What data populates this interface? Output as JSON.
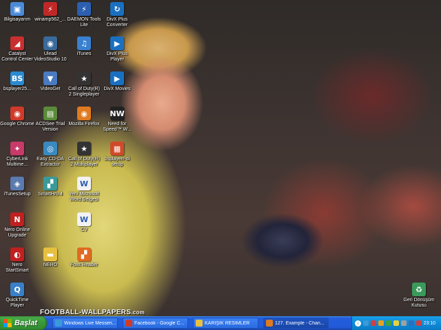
{
  "desktop": {
    "icons": [
      {
        "label": "Bilgisayarım",
        "color": "#4a8ad8",
        "glyph": "▣"
      },
      {
        "label": "winamp562_...",
        "color": "#c02828",
        "glyph": "⚡"
      },
      {
        "label": "DAEMON Tools\nLite",
        "color": "#2c5fb0",
        "glyph": "⚡"
      },
      {
        "label": "DivX Plus\nConverter",
        "color": "#1a70c0",
        "glyph": "↻"
      },
      {
        "label": "Catalyst\nControl Center",
        "color": "#c83030",
        "glyph": "◢"
      },
      {
        "label": "Ulead\nVideoStudio 10",
        "color": "#3a6a9a",
        "glyph": "◉"
      },
      {
        "label": "iTunes",
        "color": "#3a80d0",
        "glyph": "♫"
      },
      {
        "label": "DivX Plus\nPlayer",
        "color": "#1a70c0",
        "glyph": "▶"
      },
      {
        "label": "bsplayer25...",
        "color": "#2a8ad0",
        "glyph": "BS"
      },
      {
        "label": "VideoGet",
        "color": "#4a7ac0",
        "glyph": "▼"
      },
      {
        "label": "Call of Duty(R)\n2 Singleplayer",
        "color": "#333333",
        "glyph": "★"
      },
      {
        "label": "DivX Movies",
        "color": "#1a70c0",
        "glyph": "▶"
      },
      {
        "label": "Google Chrome",
        "color": "#d03a2a",
        "glyph": "◉"
      },
      {
        "label": "ACDSee Trial\nVersion",
        "color": "#5a8a3a",
        "glyph": "▤"
      },
      {
        "label": "Mozilla Firefox",
        "color": "#e07a20",
        "glyph": "◉"
      },
      {
        "label": "Need for\nSpeed™ W...",
        "color": "#222222",
        "glyph": "NW"
      },
      {
        "label": "CyberLink\nMultime...",
        "color": "#c83a6a",
        "glyph": "✦"
      },
      {
        "label": "Easy CD-DA\nExtractor",
        "color": "#3a8ac0",
        "glyph": "◎"
      },
      {
        "label": "Call of Duty(R)\n2 Multiplayer",
        "color": "#333333",
        "glyph": "★"
      },
      {
        "label": "bsplayerr-di\nsetup",
        "color": "#d04a2a",
        "glyph": "▦"
      },
      {
        "label": "iTunesSetup",
        "color": "#5a7ab0",
        "glyph": "◈"
      },
      {
        "label": "SmartHru 4",
        "color": "#3a9a9a",
        "glyph": "▞"
      },
      {
        "label": "Yeni Microsoft\nWord Belgesi",
        "color": "#f2f2f2",
        "glyph": "W"
      },
      {
        "label": "Nero Online\nUpgrade",
        "color": "#c02020",
        "glyph": "N"
      },
      {
        "label": "CV",
        "color": "#f2f2f2",
        "glyph": "W"
      },
      {
        "label": "Nero\nStartSmart",
        "color": "#c02020",
        "glyph": "◐"
      },
      {
        "label": "NERO",
        "color": "#e8c040",
        "glyph": "▬"
      },
      {
        "label": "Foxit Reader",
        "color": "#e06a20",
        "glyph": "▞"
      },
      {
        "label": "QuickTime\nPlayer",
        "color": "#3a80c8",
        "glyph": "Q"
      },
      {
        "label": "Geri Dönüşüm\nKutusu",
        "color": "#3a9a5a",
        "glyph": "♻"
      }
    ],
    "watermark": {
      "main": "FOOTBALL-WALLPAPERS",
      "domain": ".com"
    }
  },
  "taskbar": {
    "start_label": "Başlat",
    "tasks": [
      {
        "label": "Windows Live Messen...",
        "color": "#3a9ad8"
      },
      {
        "label": "Facebook - Google C...",
        "color": "#d03a2a"
      },
      {
        "label": "KARIŞIK RESİMLER",
        "color": "#e8c040"
      },
      {
        "label": "127. Example - Chan...",
        "color": "#e07a20"
      }
    ],
    "tray": {
      "icon_colors": [
        "#3a9ad8",
        "#d04040",
        "#e8a020",
        "#40a040",
        "#e8d040",
        "#a0a0a0",
        "#2a70c0",
        "#d04040"
      ],
      "clock": "23:10"
    }
  }
}
